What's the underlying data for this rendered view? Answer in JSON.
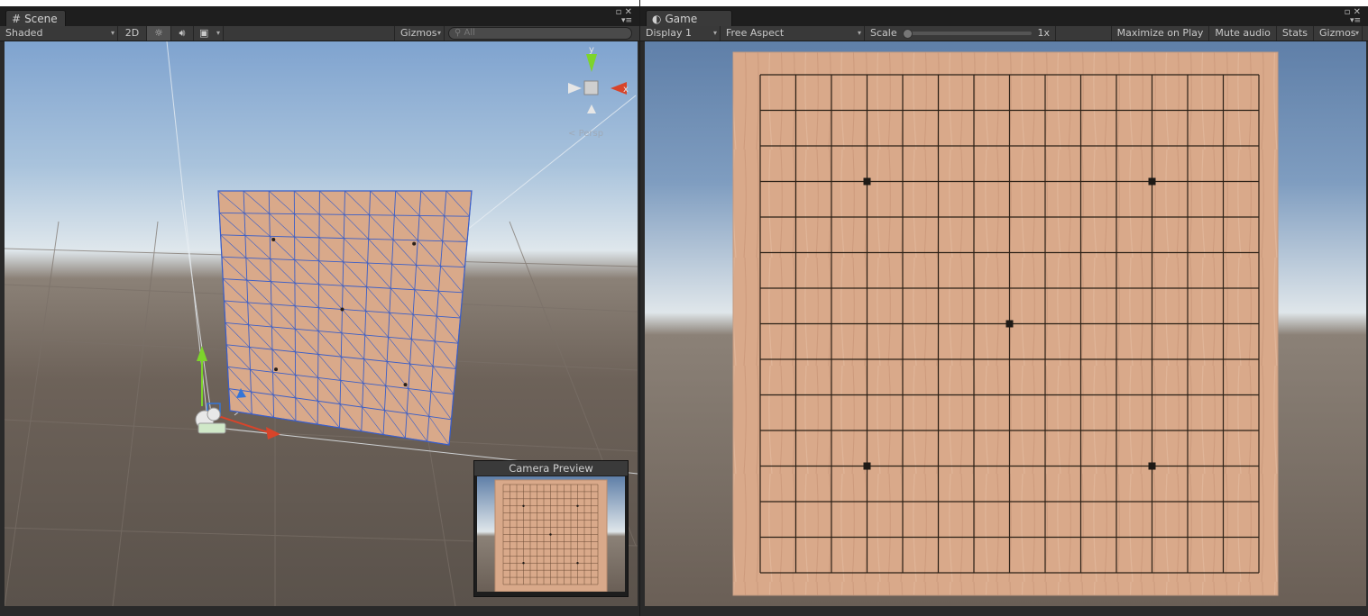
{
  "scene": {
    "tab_label": "Scene",
    "shading_mode": "Shaded",
    "toggle_2d": "2D",
    "gizmos_label": "Gizmos",
    "search_placeholder": "All",
    "view_label": "Persp",
    "axis_y": "y",
    "axis_x": "x",
    "camera_preview_title": "Camera Preview"
  },
  "game": {
    "tab_label": "Game",
    "display": "Display 1",
    "aspect": "Free Aspect",
    "scale_label": "Scale",
    "scale_value": "1x",
    "scale_level": 0.0,
    "maximize_label": "Maximize on Play",
    "mute_label": "Mute audio",
    "stats_label": "Stats",
    "gizmos_label": "Gizmos",
    "board_lines": 15,
    "star_points": [
      [
        3,
        3
      ],
      [
        11,
        3
      ],
      [
        7,
        7
      ],
      [
        3,
        11
      ],
      [
        11,
        11
      ]
    ]
  },
  "colors": {
    "board_wood": "#d9a98a",
    "grid_line": "#2b2016",
    "star_point": "#1e1a16",
    "selection_wire": "#3a5ec8"
  }
}
